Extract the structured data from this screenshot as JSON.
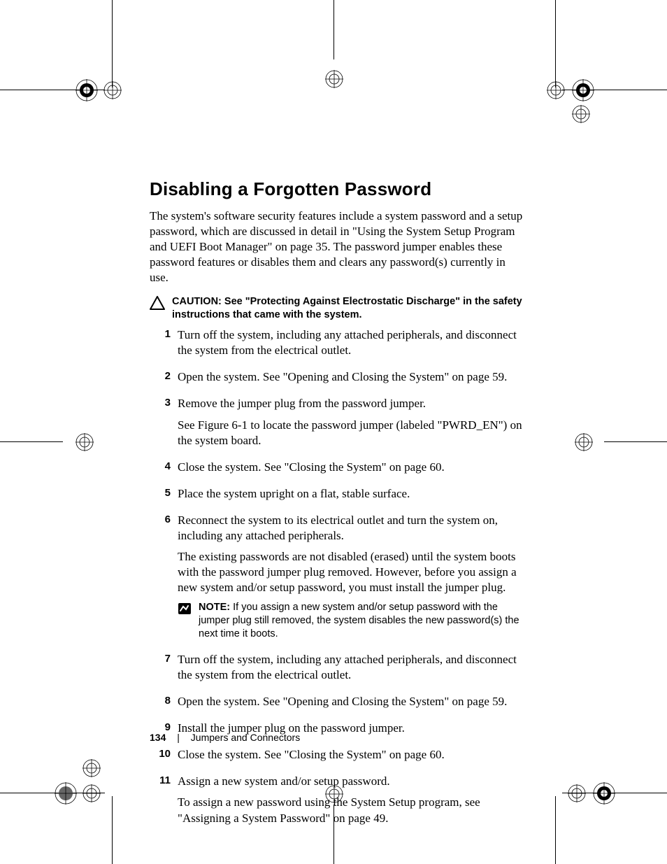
{
  "heading": "Disabling a Forgotten Password",
  "intro": "The system's software security features include a system password and a setup password, which are discussed in detail in \"Using the System Setup Program and UEFI Boot Manager\" on page 35. The password jumper enables these password features or disables them and clears any password(s) currently in use.",
  "caution": {
    "label": "CAUTION: ",
    "text": "See \"Protecting Against Electrostatic Discharge\" in the safety instructions that came with the system."
  },
  "steps": {
    "1": {
      "num": "1",
      "p1": "Turn off the system, including any attached peripherals, and disconnect the system from the electrical outlet."
    },
    "2": {
      "num": "2",
      "p1": "Open the system. See \"Opening and Closing the System\" on page 59."
    },
    "3": {
      "num": "3",
      "p1": "Remove the jumper plug from the password jumper.",
      "p2": "See Figure 6-1 to locate the password jumper (labeled \"PWRD_EN\") on the system board."
    },
    "4": {
      "num": "4",
      "p1": "Close the system. See \"Closing the System\" on page 60."
    },
    "5": {
      "num": "5",
      "p1": "Place the system upright on a flat, stable surface."
    },
    "6": {
      "num": "6",
      "p1": "Reconnect the system to its electrical outlet and turn the system on, including any attached peripherals.",
      "p2": "The existing passwords are not disabled (erased) until the system boots with the password jumper plug removed. However, before you assign a new system and/or setup password, you must install the jumper plug."
    },
    "7": {
      "num": "7",
      "p1": "Turn off the system, including any attached peripherals, and disconnect the system from the electrical outlet."
    },
    "8": {
      "num": "8",
      "p1": "Open the system. See \"Opening and Closing the System\" on page 59."
    },
    "9": {
      "num": "9",
      "p1": "Install the jumper plug on the password jumper."
    },
    "10": {
      "num": "10",
      "p1": "Close the system. See \"Closing the System\" on page 60."
    },
    "11": {
      "num": "11",
      "p1": "Assign a new system and/or setup password.",
      "p2": "To assign a new password using the System Setup program, see \"Assigning a System Password\" on page 49."
    }
  },
  "note": {
    "label": "NOTE: ",
    "text": "If you assign a new system and/or setup password with the jumper plug still removed, the system disables the new password(s) the next time it boots."
  },
  "footer": {
    "page": "134",
    "sep": "|",
    "section": "Jumpers and Connectors"
  }
}
